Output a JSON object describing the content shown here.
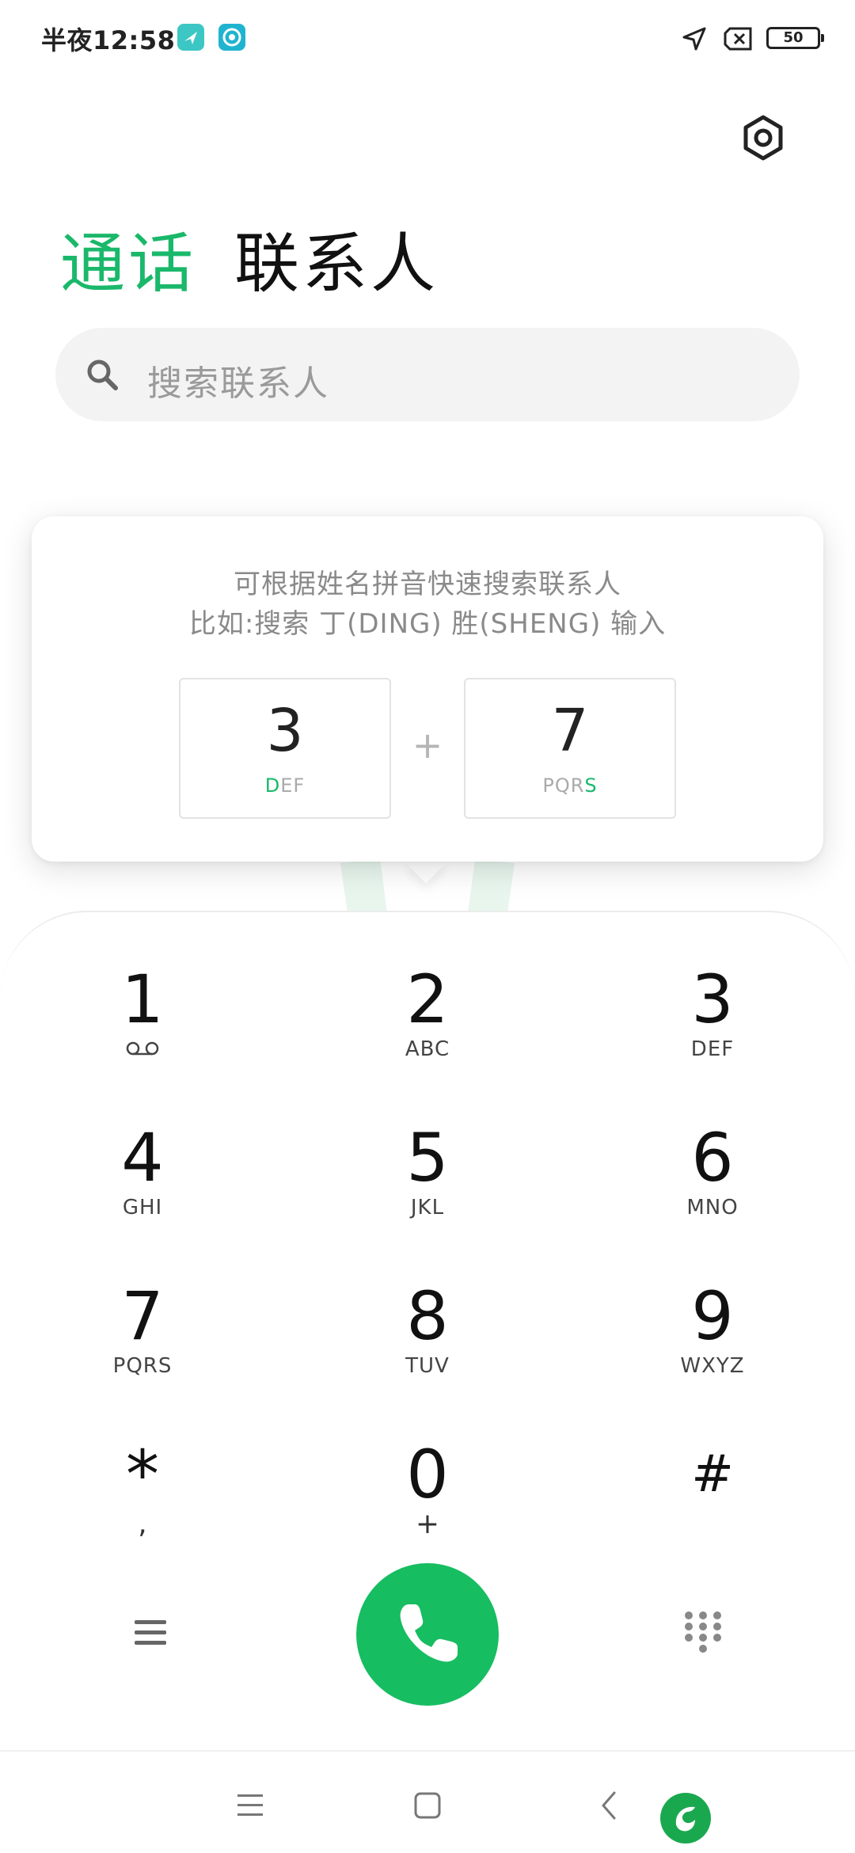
{
  "status_bar": {
    "time": "半夜12:58",
    "battery": "50",
    "icons": [
      "app-notification-icon",
      "app-notification-icon",
      "location-icon",
      "no-sim-icon",
      "battery-icon"
    ]
  },
  "header": {
    "tabs": [
      {
        "label": "通话",
        "active": true
      },
      {
        "label": "联系人",
        "active": false
      }
    ]
  },
  "search": {
    "placeholder": "搜索联系人"
  },
  "tip": {
    "line1": "可根据姓名拼音快速搜索联系人",
    "line2": "比如:搜索 丁(DING) 胜(SHENG) 输入",
    "plus": "+",
    "examples": [
      {
        "digit": "3",
        "letters_pre": "",
        "letters_hl": "D",
        "letters_post": "EF"
      },
      {
        "digit": "7",
        "letters_pre": "PQR",
        "letters_hl": "S",
        "letters_post": ""
      }
    ]
  },
  "dialpad": {
    "keys": [
      {
        "digit": "1",
        "letters": ""
      },
      {
        "digit": "2",
        "letters": "ABC"
      },
      {
        "digit": "3",
        "letters": "DEF"
      },
      {
        "digit": "4",
        "letters": "GHI"
      },
      {
        "digit": "5",
        "letters": "JKL"
      },
      {
        "digit": "6",
        "letters": "MNO"
      },
      {
        "digit": "7",
        "letters": "PQRS"
      },
      {
        "digit": "8",
        "letters": "TUV"
      },
      {
        "digit": "9",
        "letters": "WXYZ"
      },
      {
        "digit": "*",
        "letters": ","
      },
      {
        "digit": "0",
        "letters": "+"
      },
      {
        "digit": "#",
        "letters": ""
      }
    ]
  },
  "colors": {
    "accent": "#1ab86a",
    "call_button": "#16bd61"
  }
}
